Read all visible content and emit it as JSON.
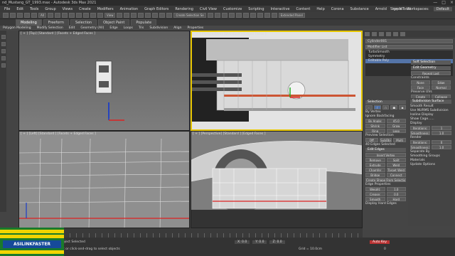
{
  "window": {
    "title": "nd_Mustang_GT_1993.max - Autodesk 3ds Max 2021",
    "controls": [
      "—",
      "□",
      "×"
    ]
  },
  "menubar": {
    "items": [
      "File",
      "Edit",
      "Tools",
      "Group",
      "Views",
      "Create",
      "Modifiers",
      "Animation",
      "Graph Editors",
      "Rendering",
      "Civil View",
      "Customize",
      "Scripting",
      "Interactive",
      "Content",
      "Help",
      "Corona",
      "Substance",
      "Arnold",
      "rapidTools"
    ],
    "sign_in": "Sign In",
    "workspaces_label": "Workspaces:",
    "workspace_value": "Default"
  },
  "toolbar": {
    "view_dropdown": "View",
    "selection_set": "Create Selection Se",
    "extended_panel": "Extended Panel"
  },
  "ribbon": {
    "tabs": [
      "Modeling",
      "Freeform",
      "Selection",
      "Object Paint",
      "Populate"
    ],
    "active_tab": "Modeling",
    "sub_items": [
      "Polygon Modeling",
      "Modify Selection",
      "Edit",
      "Geometry (All)",
      "Edge",
      "Loops",
      "Tris",
      "Subdivision",
      "Align",
      "Properties"
    ]
  },
  "viewports": {
    "top_left": "[ + ] [Top] [Standard ] [Facets + Edged Faces ]",
    "top_right": "[ + ] [Perspective] [Standard ] [Edged Faces ]",
    "bottom_left": "[ + ] [Left] [Standard ] [Facets + Edged Faces ]",
    "bottom_right": "[ + ] [Perspective] [Standard ] [Edged Faces ]"
  },
  "command_panel": {
    "object_name": "Cylinder001",
    "modifier_list": "Modifier List",
    "stack": [
      "TurboSmooth",
      "Symmetry",
      "Editable Poly"
    ],
    "selected_stack_item": "Editable Poly",
    "soft_selection": "Soft Selection",
    "edit_geometry": "Edit Geometry",
    "repeat_last": "Repeat Last",
    "constraints": "Constraints",
    "constraint_options": [
      "None",
      "Edge",
      "Face",
      "Normal"
    ],
    "preserve_uvs": "Preserve UVs",
    "create": "Create",
    "collapse": "Collapse",
    "attach": "Attach",
    "detach": "Detach",
    "slice_plane": "Slice Plane",
    "split": "Split",
    "slice": "Slice",
    "reset_plane": "Reset Plane",
    "quickslice": "QuickSlice",
    "cut": "Cut",
    "meshsmooth": "MSmooth",
    "tessellate": "Tessellate",
    "make_planar": "Make Planar",
    "view_align": "View Align",
    "grid_align": "Grid Align",
    "relax": "Relax",
    "hide_selected": "Hide Selected",
    "unhide_all": "Unhide All",
    "hide_unselected": "Hide Unselected",
    "named_selections": "Named Selections:",
    "copy": "Copy",
    "paste": "Paste",
    "delete_isolated": "Delete Isolated Vertices",
    "full_interactivity": "Full Interactivity"
  },
  "selection_panel": {
    "title": "Selection",
    "by_vertex": "By Vertex",
    "ignore_backfacing": "Ignore Backfacing",
    "by_angle": "By Angle:",
    "angle_value": "45.0",
    "shrink": "Shrink",
    "grow": "Grow",
    "ring": "Ring",
    "loop": "Loop",
    "preview_selection": "Preview Selection",
    "preview_options": [
      "Off",
      "SubObj",
      "Multi"
    ],
    "status": "40 Edges Selected"
  },
  "edit_edges": {
    "title": "Edit Edges",
    "insert_vertex": "Insert Vertex",
    "remove": "Remove",
    "split": "Split",
    "extrude": "Extrude",
    "weld": "Weld",
    "chamfer": "Chamfer",
    "target_weld": "Target Weld",
    "bridge": "Bridge",
    "connect": "Connect",
    "create_shape": "Create Shape From Selection",
    "edge_properties": "Edge Properties",
    "weight_label": "Weight:",
    "weight_value": "1.0",
    "crease_label": "Crease:",
    "crease_value": "0.0",
    "smooth": "Smooth",
    "hard": "Hard",
    "display_hard_edges": "Display Hard Edges"
  },
  "subdivision_surface": {
    "title": "Subdivision Surface",
    "smooth_result": "Smooth Result",
    "use_nurms": "Use NURMS Subdivision",
    "isoline_display": "Isoline Display",
    "show_cage": "Show Cage......",
    "display": "Display",
    "iterations_label": "Iterations:",
    "iterations_value": "1",
    "smoothness_label": "Smoothness:",
    "smoothness_value": "1.0",
    "render": "Render",
    "render_iterations": "0",
    "render_smoothness": "1.0",
    "separate_by": "Separate By",
    "smoothing_groups": "Smoothing Groups",
    "materials": "Materials",
    "update_options": "Update Options"
  },
  "timeline": {
    "slider": "0 / 100"
  },
  "status": {
    "line1": "1 Object Selected",
    "line2": "Click or click-and-drag to select objects",
    "x": "X: 0.0",
    "y": "Y: 0.0",
    "z": "Z: 0.0",
    "grid": "Grid = 10.0cm",
    "add_time_tag": "Add Time Tag",
    "auto_key": "Auto Key",
    "set_key": "Set Key",
    "selected": "Selected",
    "frame": "0"
  },
  "logo": {
    "text": "ASILINKFASTER"
  }
}
